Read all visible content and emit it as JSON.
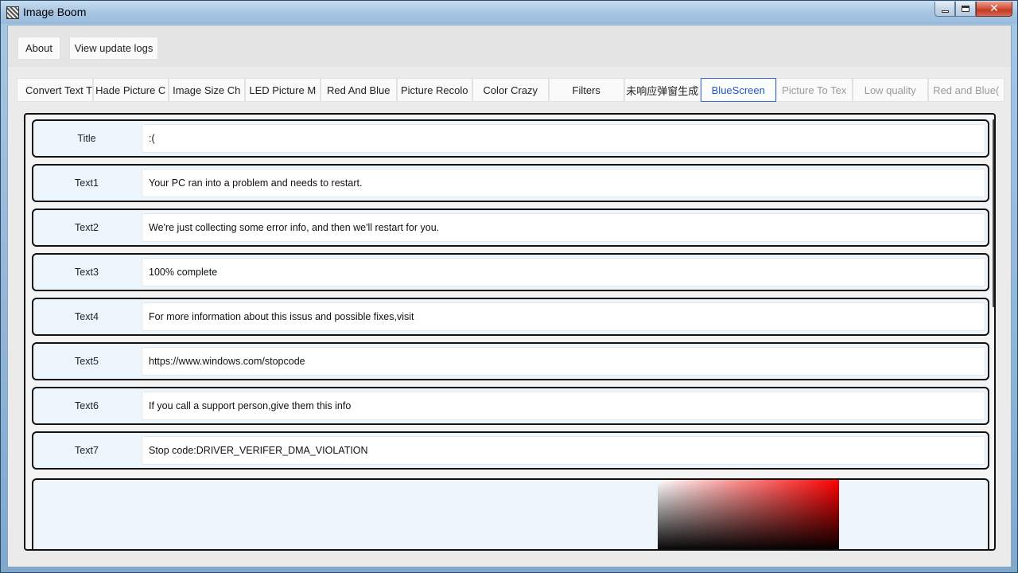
{
  "window": {
    "title": "Image Boom",
    "controls": {
      "minimize": "",
      "maximize": "",
      "close": "✕"
    }
  },
  "top_buttons": {
    "about": "About",
    "update_logs": "View update logs"
  },
  "tabs": [
    {
      "label": "Convert Text T",
      "state": "normal"
    },
    {
      "label": "Hade Picture C",
      "state": "normal"
    },
    {
      "label": "Image Size Ch",
      "state": "normal"
    },
    {
      "label": "LED Picture M",
      "state": "normal"
    },
    {
      "label": "Red And Blue",
      "state": "normal"
    },
    {
      "label": "Picture Recolo",
      "state": "normal"
    },
    {
      "label": "Color Crazy",
      "state": "normal"
    },
    {
      "label": "Filters",
      "state": "normal"
    },
    {
      "label": "未响应弹窗生成",
      "state": "normal"
    },
    {
      "label": "BlueScreen",
      "state": "active"
    },
    {
      "label": "Picture To Tex",
      "state": "disabled"
    },
    {
      "label": "Low quality",
      "state": "disabled"
    },
    {
      "label": "Red and Blue(",
      "state": "disabled"
    }
  ],
  "fields": [
    {
      "label": "Title",
      "value": ":("
    },
    {
      "label": "Text1",
      "value": "Your PC ran into a problem and needs to restart."
    },
    {
      "label": "Text2",
      "value": "We're just collecting some error info, and then we'll restart for you."
    },
    {
      "label": "Text3",
      "value": "100% complete"
    },
    {
      "label": "Text4",
      "value": "For more information about this issus and possible fixes,visit"
    },
    {
      "label": "Text5",
      "value": "https://www.windows.com/stopcode"
    },
    {
      "label": "Text6",
      "value": "If you call a support person,give them this info"
    },
    {
      "label": "Text7",
      "value": "Stop code:DRIVER_VERIFER_DMA_VIOLATION"
    }
  ],
  "colors": {
    "active_tab": "#3b6fcf",
    "picker_hue": "#ff0000"
  }
}
